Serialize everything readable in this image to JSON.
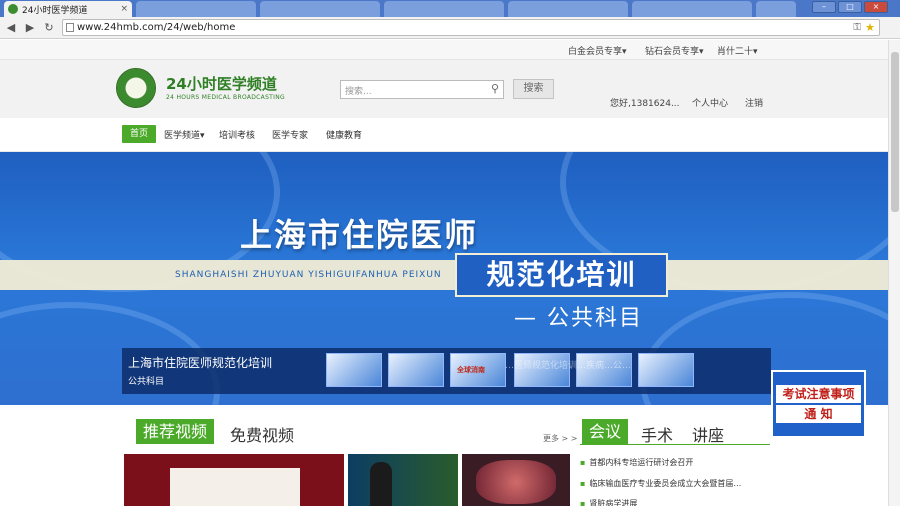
{
  "browser": {
    "tab_title": "24小时医学频道",
    "tab_close": "×",
    "url": "www.24hmb.com/24/web/home",
    "menu_icon": "≡"
  },
  "topbar": {
    "items": [
      "白金会员专享▾",
      "钻石会员专享▾",
      "肖什二十▾"
    ]
  },
  "header": {
    "logo_title": "24小时医学频道",
    "logo_sub": "24 HOURS MEDICAL BROADCASTING",
    "search_placeholder": "搜索...",
    "search_button": "搜索",
    "greeting": "您好,1381624...",
    "user_center": "个人中心",
    "logout": "注销"
  },
  "nav": {
    "items": [
      "首页",
      "医学频道▾",
      "培训考核",
      "医学专家",
      "健康教育"
    ]
  },
  "banner": {
    "title": "上海市住院医师",
    "pinyin": "SHANGHAISHI ZHUYUAN YISHIGUIFANHUA PEIXUN",
    "box_title": "规范化培训",
    "subtitle": "— 公共科目"
  },
  "slider": {
    "title": "上海市住院医师规范化培训",
    "subtitle": "公共科目",
    "overlay": "…医师规范化培训…疾病…公…",
    "thumbs": [
      "",
      "",
      "全球消南",
      "",
      "",
      ""
    ]
  },
  "notice": {
    "line1": "考试注意事项",
    "line2": "通 知"
  },
  "video_section": {
    "tabs": [
      "推荐视频",
      "免费视频"
    ],
    "more": "更多 > >"
  },
  "news_section": {
    "tabs": [
      "会议",
      "手术",
      "讲座"
    ],
    "items": [
      "首都内科专培运行研讨会召开",
      "临床输血医疗专业委员会成立大会暨首届…",
      "肾脏病学进展"
    ]
  }
}
